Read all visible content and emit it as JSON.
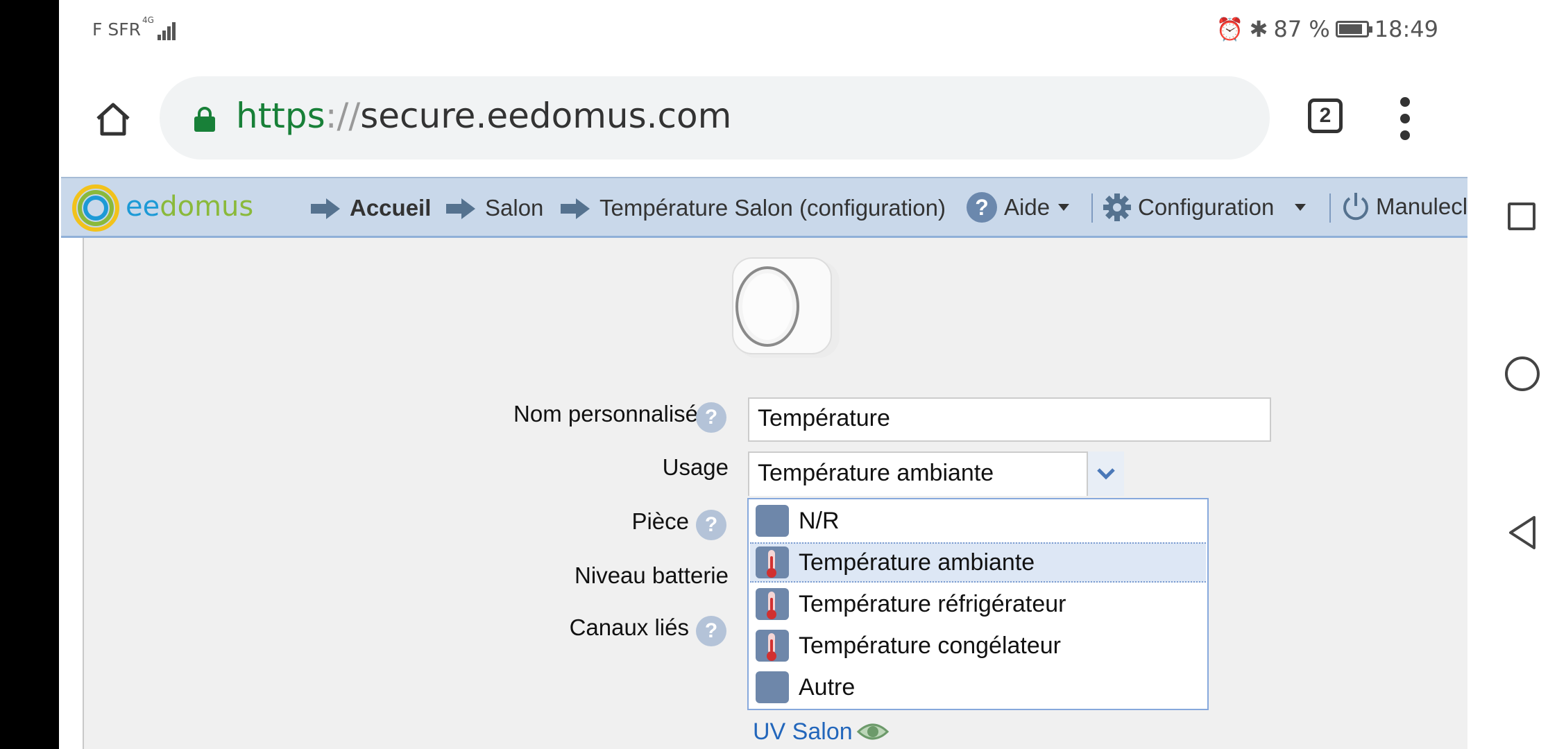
{
  "status": {
    "carrier": "F SFR",
    "network": "4G",
    "battery": "87 %",
    "time": "18:49",
    "battery_level": 0.87
  },
  "browser": {
    "url_scheme": "https",
    "url_sep": "://",
    "url_host": "secure.eedomus.com",
    "tab_count": "2"
  },
  "header": {
    "logo_prefix": "ee",
    "logo_rest": "domus",
    "crumbs": [
      "Accueil",
      "Salon",
      "Température Salon (configuration)"
    ],
    "help": "Aide",
    "help_icon_text": "?",
    "configuration": "Configuration",
    "user": "Manulecl"
  },
  "form": {
    "name_label": "Nom personnalisé",
    "name_value": "Température",
    "usage_label": "Usage",
    "usage_value": "Température ambiante",
    "room_label": "Pièce",
    "battery_label": "Niveau batterie",
    "channels_label": "Canaux liés",
    "help_text": "?"
  },
  "dropdown": {
    "options": [
      "N/R",
      "Température ambiante",
      "Température réfrigérateur",
      "Température congélateur",
      "Autre"
    ],
    "selected_index": 1
  },
  "linked": {
    "uv_link": "UV Salon"
  },
  "colors": {
    "accent": "#8ab93b",
    "brand_blue": "#1d9ad6",
    "header_bg": "#c9d8ea",
    "link": "#2266bb"
  },
  "icons": [
    "home-icon",
    "lock-icon",
    "more-vert-icon",
    "arrow-right-icon",
    "help-icon",
    "gear-icon",
    "power-icon",
    "chevron-down-icon",
    "thermometer-icon",
    "eye-icon"
  ]
}
